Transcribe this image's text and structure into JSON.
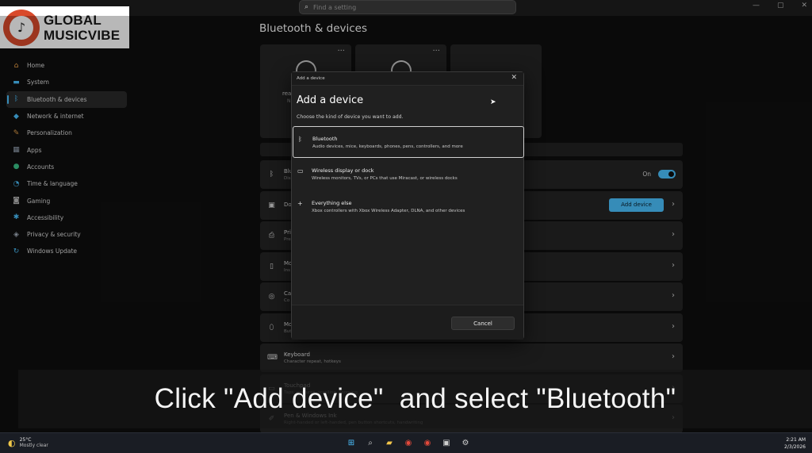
{
  "search": {
    "placeholder": "Find a setting"
  },
  "logo": {
    "line1": "GLOBAL",
    "line2": "MUSICVIBE"
  },
  "sidebar": {
    "items": [
      {
        "label": "Home",
        "icon": "home-icon",
        "glyph": "⌂",
        "color": "#f3a64a"
      },
      {
        "label": "System",
        "icon": "monitor-icon",
        "glyph": "▬",
        "color": "#4cc2ff"
      },
      {
        "label": "Bluetooth & devices",
        "icon": "bluetooth-icon",
        "glyph": "ᛒ",
        "color": "#4cc2ff",
        "active": true
      },
      {
        "label": "Network & internet",
        "icon": "wifi-icon",
        "glyph": "◆",
        "color": "#4cc2ff"
      },
      {
        "label": "Personalization",
        "icon": "brush-icon",
        "glyph": "✎",
        "color": "#e7a14a"
      },
      {
        "label": "Apps",
        "icon": "apps-icon",
        "glyph": "▦",
        "color": "#9aa7b8"
      },
      {
        "label": "Accounts",
        "icon": "person-icon",
        "glyph": "●",
        "color": "#3cc48a"
      },
      {
        "label": "Time & language",
        "icon": "clock-globe-icon",
        "glyph": "◔",
        "color": "#4cc2ff"
      },
      {
        "label": "Gaming",
        "icon": "gamepad-icon",
        "glyph": "◙",
        "color": "#b8b8b8"
      },
      {
        "label": "Accessibility",
        "icon": "accessibility-icon",
        "glyph": "✱",
        "color": "#4cc2ff"
      },
      {
        "label": "Privacy & security",
        "icon": "shield-icon",
        "glyph": "◈",
        "color": "#a9b4c2"
      },
      {
        "label": "Windows Update",
        "icon": "update-icon",
        "glyph": "↻",
        "color": "#4cc2ff"
      }
    ]
  },
  "main": {
    "title": "Bluetooth & devices",
    "tiles": [
      {
        "name": "rea",
        "sub": "N"
      },
      {
        "name": "",
        "sub": ""
      }
    ],
    "rows": [
      {
        "icon": "bluetooth-icon",
        "glyph": "ᛒ",
        "title": "Blu",
        "sub": "Dis",
        "toggle": true,
        "toggle_label": "On"
      },
      {
        "icon": "devices-icon",
        "glyph": "▣",
        "title": "Do",
        "sub": "",
        "button": "Add device"
      },
      {
        "icon": "printer-icon",
        "glyph": "⎙",
        "title": "Pri",
        "sub": "Pre"
      },
      {
        "icon": "phone-icon",
        "glyph": "▯",
        "title": "Mo",
        "sub": "Ins"
      },
      {
        "icon": "camera-icon",
        "glyph": "◎",
        "title": "Ca",
        "sub": "Co"
      },
      {
        "icon": "mouse-icon",
        "glyph": "⬯",
        "title": "Mo",
        "sub": "Buttons, mouse pointer speed, scrolling"
      },
      {
        "icon": "keyboard-icon",
        "glyph": "⌨",
        "title": "Keyboard",
        "sub": "Character repeat, hotkeys"
      },
      {
        "icon": "touchpad-icon",
        "glyph": "▭",
        "title": "Touchpad",
        "sub": "Taps, gestures, scrolling, zooming"
      },
      {
        "icon": "pen-icon",
        "glyph": "✐",
        "title": "Pen & Windows Ink",
        "sub": "Right-handed or left-handed, pen button shortcuts, handwriting"
      }
    ]
  },
  "dialog": {
    "bar_title": "Add a device",
    "title": "Add a device",
    "subtitle": "Choose the kind of device you want to add.",
    "options": [
      {
        "icon": "bluetooth-icon",
        "glyph": "ᛒ",
        "title": "Bluetooth",
        "sub": "Audio devices, mice, keyboards, phones, pens, controllers, and more",
        "selected": true
      },
      {
        "icon": "display-icon",
        "glyph": "▭",
        "title": "Wireless display or dock",
        "sub": "Wireless monitors, TVs, or PCs that use Miracast, or wireless docks"
      },
      {
        "icon": "plus-icon",
        "glyph": "+",
        "title": "Everything else",
        "sub": "Xbox controllers with Xbox Wireless Adapter, DLNA, and other devices"
      }
    ],
    "cancel": "Cancel"
  },
  "caption": "Click \"Add device\"  and select \"Bluetooth\"",
  "taskbar": {
    "temp": "25°C",
    "weather": "Mostly clear",
    "time": "2:21 AM",
    "date": "2/3/2026"
  }
}
